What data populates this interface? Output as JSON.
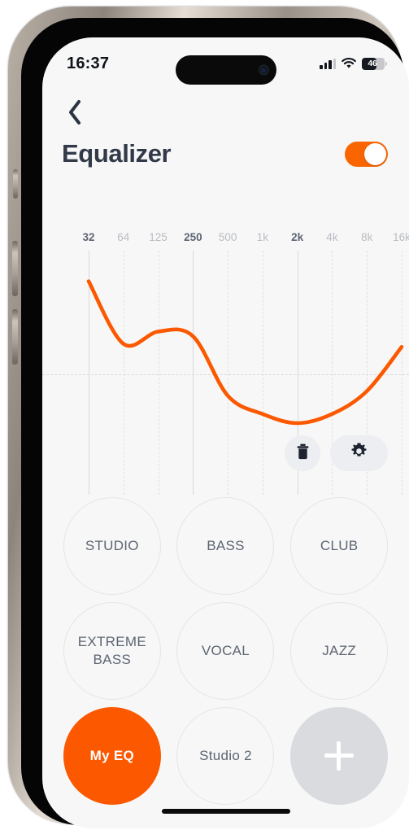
{
  "status_bar": {
    "time": "16:37",
    "signal_icon": "cellular-signal-icon",
    "wifi_icon": "wifi-icon",
    "battery_icon": "battery-icon",
    "battery_percent": "46"
  },
  "header": {
    "back_icon": "chevron-left-icon",
    "title": "Equalizer",
    "toggle_name": "equalizer-enabled-toggle",
    "toggle_on": true,
    "accent_color": "#fb5800"
  },
  "graph": {
    "delete_icon": "trash-icon",
    "settings_icon": "gear-icon"
  },
  "presets": {
    "items": [
      {
        "label": "STUDIO",
        "selected": false,
        "kind": "preset"
      },
      {
        "label": "BASS",
        "selected": false,
        "kind": "preset"
      },
      {
        "label": "CLUB",
        "selected": false,
        "kind": "preset"
      },
      {
        "label": "EXTREME BASS",
        "selected": false,
        "kind": "preset"
      },
      {
        "label": "VOCAL",
        "selected": false,
        "kind": "preset"
      },
      {
        "label": "JAZZ",
        "selected": false,
        "kind": "preset"
      },
      {
        "label": "My EQ",
        "selected": true,
        "kind": "preset"
      },
      {
        "label": "Studio 2",
        "selected": false,
        "kind": "preset"
      },
      {
        "label": "",
        "selected": false,
        "kind": "add",
        "icon": "plus-icon"
      }
    ]
  },
  "chart_data": {
    "type": "line",
    "title": "",
    "xlabel": "",
    "ylabel": "",
    "categories": [
      "32",
      "64",
      "125",
      "250",
      "500",
      "1k",
      "2k",
      "4k",
      "8k",
      "16k"
    ],
    "major_ticks": [
      "32",
      "250",
      "2k"
    ],
    "series": [
      {
        "name": "My EQ",
        "color": "#fb5800",
        "values": [
          6.1,
          2.0,
          2.8,
          2.5,
          -1.4,
          -2.6,
          -3.2,
          -2.6,
          -1.1,
          1.8
        ]
      }
    ],
    "ylim": [
      -8,
      8
    ],
    "zero_line": 0,
    "grid": true,
    "legend": "none"
  }
}
